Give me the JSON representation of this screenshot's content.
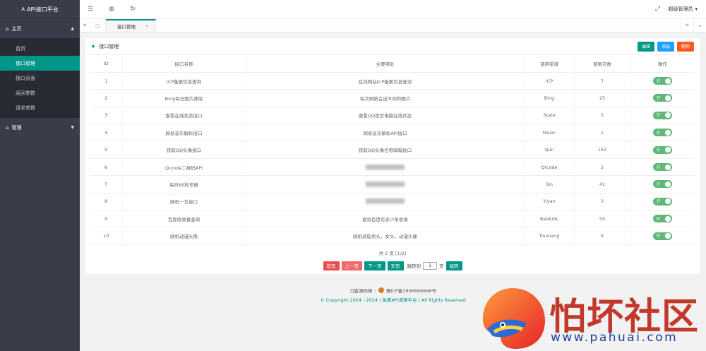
{
  "sidebar": {
    "logo_mark": "A",
    "logo": "API接口平台",
    "groups": [
      {
        "label": "主页",
        "items": [
          "首页",
          "接口管理",
          "接口页面",
          "返回参数",
          "请求参数"
        ]
      },
      {
        "label": "管理"
      }
    ]
  },
  "header": {
    "user": "超级管理员"
  },
  "tabs": {
    "active": "接口管理"
  },
  "card": {
    "title": "接口管理",
    "actions": {
      "edit": "编辑",
      "add": "添加",
      "delete": "删除"
    }
  },
  "table": {
    "columns": [
      "ID",
      "接口名称",
      "主要用处",
      "调用渠道",
      "使用次数",
      "操作"
    ],
    "switch_label": "开",
    "rows": [
      [
        "1",
        "ICP备案信息查询",
        "在线网站ICP备案信息查询",
        "ICP",
        "7"
      ],
      [
        "2",
        "Bing每日图片获取",
        "每次刷新会出不同的图片",
        "Bing",
        "25"
      ],
      [
        "3",
        "查看在线状态接口",
        "查看QQ是否电脑在线状态",
        "State",
        "2"
      ],
      [
        "4",
        "网易音乐解析接口",
        "网易音乐解析API接口",
        "Music",
        "1"
      ],
      [
        "5",
        "获取QQ头像接口",
        "获取QQ头像名称邮箱接口",
        "Qun",
        "152"
      ],
      [
        "6",
        "Qrcode二维码API",
        "",
        "Qrcode",
        "2"
      ],
      [
        "7",
        "每日60秒早报",
        "",
        "Sin",
        "41"
      ],
      [
        "8",
        "随机一言接口",
        "",
        "Yiyan",
        "3"
      ],
      [
        "9",
        "百度收录量查询",
        "查询百度有多少条收录",
        "BaiduSL",
        "55"
      ],
      [
        "10",
        "随机动漫头像",
        "随机获取男头，女头，动漫头像",
        "Touxiang",
        "5"
      ]
    ]
  },
  "pager": {
    "info": "共 2 页 [1/2]",
    "first": "首页",
    "prev": "上一页",
    "next": "下一页",
    "last": "末页",
    "jump_prefix": "跳转到",
    "page_value": "1",
    "jump_suffix": "页",
    "go": "跳转"
  },
  "footer": {
    "site": "刀客源码网",
    "separator": "-",
    "icp": "豫ICP备1906666666号",
    "copyright": "© Copyright 2024 - 2024 | 免费API调用平台 | All Rights Reserved"
  },
  "watermark": {
    "brand": "怕坏社区",
    "url": "www.pahuai.com"
  },
  "colors": {
    "accent": "#009688",
    "sidebar": "#393d49",
    "blue": "#1e9fff",
    "orange": "#ff5722",
    "switch": "#5fb878",
    "red": "#e94e4e"
  }
}
